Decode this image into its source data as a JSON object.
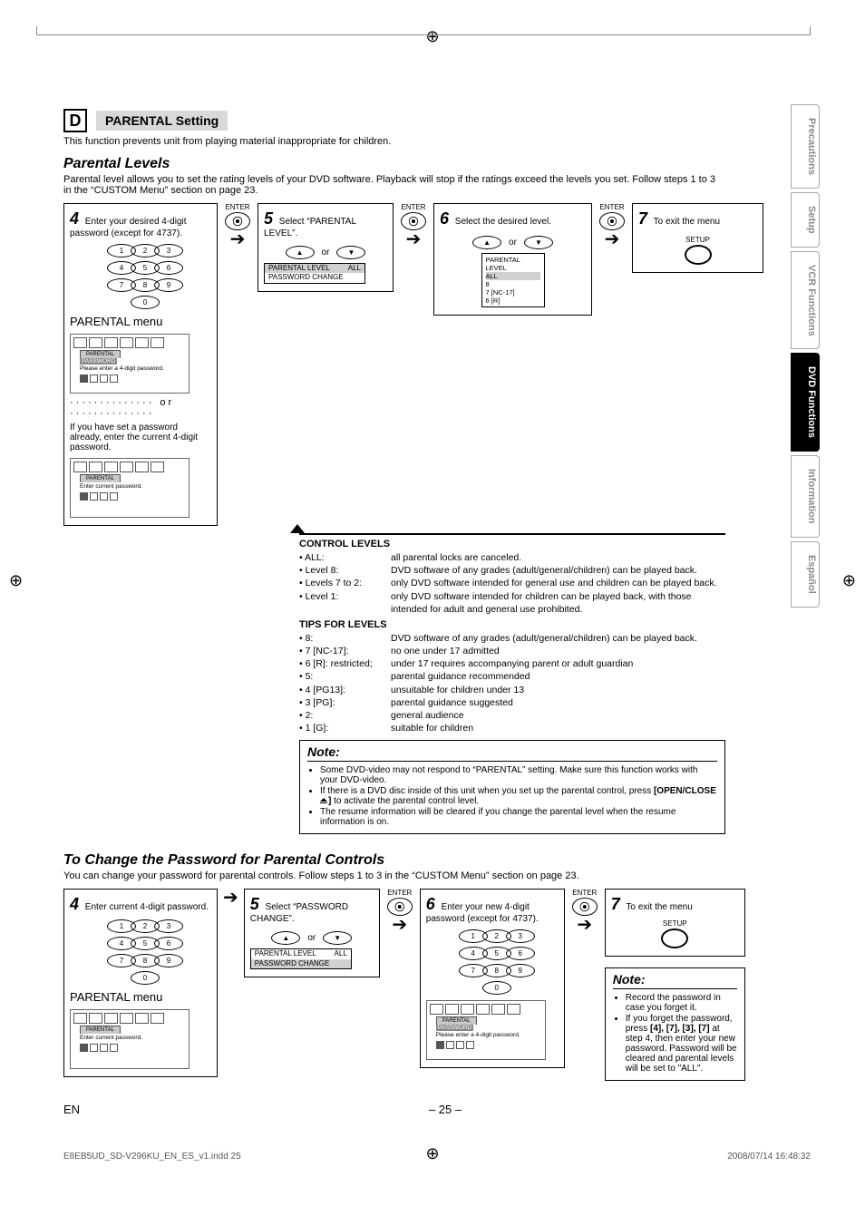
{
  "sectionLetter": "D",
  "sectionTitle": "PARENTAL Setting",
  "intro": "This function prevents unit from playing material inappropriate for children.",
  "parentalLevels": {
    "heading": "Parental Levels",
    "intro": "Parental level allows you to set the rating levels of your DVD software. Playback will stop if the ratings exceed the levels you set. Follow steps 1 to 3 in the “CUSTOM Menu” section on page 23."
  },
  "stepsA": {
    "s4": {
      "num": "4",
      "text": "Enter your desired 4-digit password (except for 4737)."
    },
    "s5": {
      "num": "5",
      "text": "Select “PARENTAL LEVEL”."
    },
    "s6": {
      "num": "6",
      "text": "Select the desired level."
    },
    "s7": {
      "num": "7",
      "text": "To exit the menu"
    },
    "enter": "ENTER",
    "setup": "SETUP",
    "menuLabel": "PARENTAL menu",
    "or": "or",
    "menuA": {
      "line1": "PARENTAL LEVEL",
      "right": "ALL",
      "line2": "PASSWORD CHANGE"
    },
    "selList": {
      "title": "PARENTAL LEVEL",
      "items": [
        "ALL",
        "8",
        "7 [NC-17]",
        "6 [R]"
      ]
    },
    "orDotted": "··············  or  ··············",
    "osd1": {
      "tab": "PARENTAL",
      "hilite": "PASSWORD",
      "line": "Please enter a 4-digit password."
    },
    "alt4": "If you have set a password already, enter the current 4-digit password.",
    "osd2": {
      "tab": "PARENTAL",
      "line": "Enter current password."
    }
  },
  "control": {
    "heading": "CONTROL LEVELS",
    "items": [
      {
        "lbl": "• ALL:",
        "desc": "all parental locks are canceled."
      },
      {
        "lbl": "• Level 8:",
        "desc": "DVD software of any grades (adult/general/children) can be played back."
      },
      {
        "lbl": "• Levels 7 to 2:",
        "desc": "only DVD software intended for general use and children can be played back."
      },
      {
        "lbl": "• Level 1:",
        "desc": "only DVD software intended for children can be played back, with those intended for adult and general use prohibited."
      }
    ],
    "tips": "TIPS FOR LEVELS",
    "tipsItems": [
      {
        "lbl": "• 8:",
        "desc": "DVD software of any grades (adult/general/children) can be played back."
      },
      {
        "lbl": "• 7 [NC-17]:",
        "desc": "no one under 17 admitted"
      },
      {
        "lbl": "• 6 [R]: restricted;",
        "desc": "under 17 requires accompanying parent or adult guardian"
      },
      {
        "lbl": "• 5:",
        "desc": "parental guidance recommended"
      },
      {
        "lbl": "• 4 [PG13]:",
        "desc": "unsuitable for children under 13"
      },
      {
        "lbl": "• 3 [PG]:",
        "desc": "parental guidance suggested"
      },
      {
        "lbl": "• 2:",
        "desc": "general audience"
      },
      {
        "lbl": "• 1 [G]:",
        "desc": "suitable for children"
      }
    ]
  },
  "noteA": {
    "heading": "Note:",
    "items": [
      "Some DVD-video may not respond to “PARENTAL” setting. Make sure this function works with your DVD-video.",
      "If there is a DVD disc inside of this unit when you set up the parental control, press [OPEN/CLOSE ▲] to activate the parental control level.",
      "The resume information will be cleared if you change the parental level when the resume information is on."
    ],
    "openclose": "[OPEN/CLOSE "
  },
  "changePwd": {
    "heading": "To Change the Password for Parental Controls",
    "intro": "You can change your password for parental controls.  Follow steps 1 to 3 in the “CUSTOM Menu” section on page 23."
  },
  "stepsB": {
    "s4": {
      "num": "4",
      "text": "Enter current 4-digit password."
    },
    "s5": {
      "num": "5",
      "text": "Select “PASSWORD CHANGE”."
    },
    "s6": {
      "num": "6",
      "text": "Enter your new 4-digit password (except for 4737)."
    },
    "s7": {
      "num": "7",
      "text": "To exit the menu"
    },
    "menuB": {
      "line1": "PARENTAL LEVEL",
      "right": "ALL",
      "line2": "PASSWORD CHANGE"
    },
    "menuLabel": "PARENTAL menu",
    "osd3": {
      "tab": "PARENTAL",
      "line": "Enter current password."
    },
    "osd4": {
      "tab": "PARENTAL",
      "hilite": "PASSWORD",
      "line": "Please enter a 4-digit password."
    }
  },
  "noteB": {
    "heading": "Note:",
    "items": [
      "Record the password in case you forget it.",
      "If you forget the password, press [4], [7], [3], [7] at step 4, then enter your new password. Password will be cleared and parental levels will be set to “ALL”."
    ],
    "bold": "[4], [7], [3], [7]"
  },
  "sideTabs": [
    "Precautions",
    "Setup",
    "VCR Functions",
    "DVD Functions",
    "Information",
    "Español"
  ],
  "footer": {
    "left": "EN",
    "center": "– 25 –"
  },
  "imprint": {
    "left": "E8EB5UD_SD-V296KU_EN_ES_v1.indd   25",
    "right": "2008/07/14   16:48:32"
  }
}
